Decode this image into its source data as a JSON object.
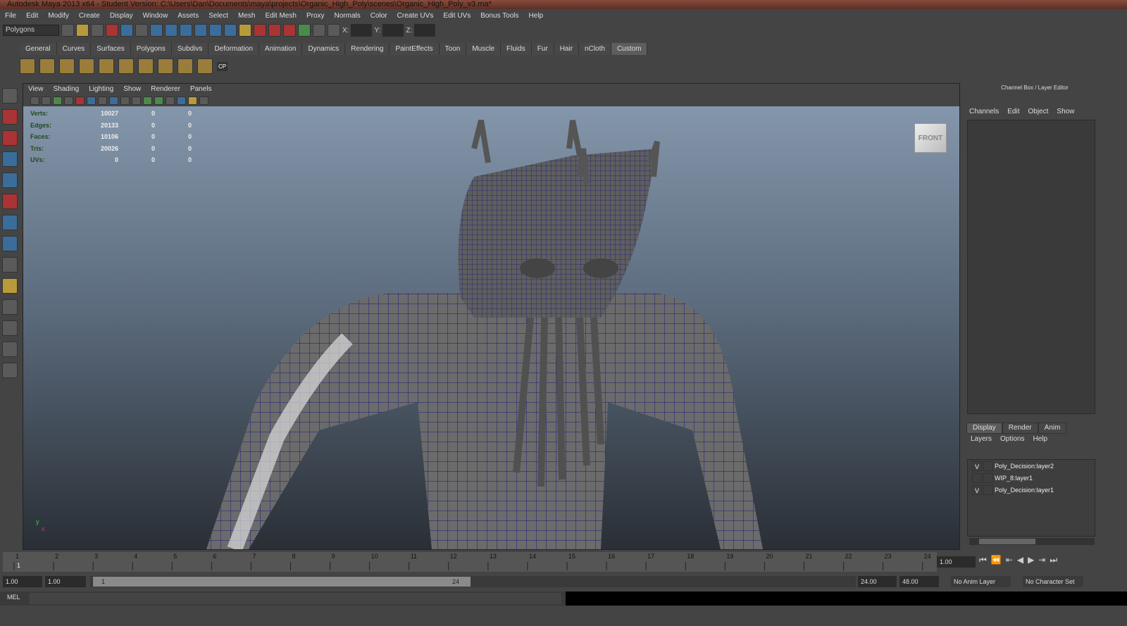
{
  "title": "Autodesk Maya 2013 x64 - Student Version: C:\\Users\\Dan\\Documents\\maya\\projects\\Organic_High_Poly\\scenes\\Organic_High_Poly_v3.ma*",
  "menu": [
    "File",
    "Edit",
    "Modify",
    "Create",
    "Display",
    "Window",
    "Assets",
    "Select",
    "Mesh",
    "Edit Mesh",
    "Proxy",
    "Normals",
    "Color",
    "Create UVs",
    "Edit UVs",
    "Bonus Tools",
    "Help"
  ],
  "toolbar": {
    "mode": "Polygons",
    "x_label": "X:",
    "y_label": "Y:",
    "z_label": "Z:"
  },
  "shelf_tabs": [
    "General",
    "Curves",
    "Surfaces",
    "Polygons",
    "Subdivs",
    "Deformation",
    "Animation",
    "Dynamics",
    "Rendering",
    "PaintEffects",
    "Toon",
    "Muscle",
    "Fluids",
    "Fur",
    "Hair",
    "nCloth",
    "Custom"
  ],
  "shelf_active": "Custom",
  "shelf_cp": "CP",
  "viewport": {
    "menu": [
      "View",
      "Shading",
      "Lighting",
      "Show",
      "Renderer",
      "Panels"
    ],
    "hud": [
      {
        "label": "Verts:",
        "v": [
          "10027",
          "0",
          "0"
        ]
      },
      {
        "label": "Edges:",
        "v": [
          "20133",
          "0",
          "0"
        ]
      },
      {
        "label": "Faces:",
        "v": [
          "10106",
          "0",
          "0"
        ]
      },
      {
        "label": "Tris:",
        "v": [
          "20026",
          "0",
          "0"
        ]
      },
      {
        "label": "UVs:",
        "v": [
          "0",
          "0",
          "0"
        ]
      }
    ],
    "view_cube": "FRONT",
    "axis_y": "y",
    "axis_x": "x"
  },
  "channel_box": {
    "title": "Channel Box / Layer Editor",
    "menu": [
      "Channels",
      "Edit",
      "Object",
      "Show"
    ]
  },
  "layer_editor": {
    "tabs": [
      "Display",
      "Render",
      "Anim"
    ],
    "active_tab": "Display",
    "menu": [
      "Layers",
      "Options",
      "Help"
    ],
    "layers": [
      {
        "vis": "V",
        "name": "Poly_Decision:layer2"
      },
      {
        "vis": "",
        "name": "WIP_8:layer1"
      },
      {
        "vis": "V",
        "name": "Poly_Decision:layer1"
      }
    ]
  },
  "timeline": {
    "ticks": [
      "1",
      "2",
      "3",
      "4",
      "5",
      "6",
      "7",
      "8",
      "9",
      "10",
      "11",
      "12",
      "13",
      "14",
      "15",
      "16",
      "17",
      "18",
      "19",
      "20",
      "21",
      "22",
      "23",
      "24"
    ],
    "current_frame": "1",
    "current_time": "1.00"
  },
  "range": {
    "start": "1.00",
    "playback_start": "1.00",
    "slider_start": "1",
    "slider_end": "24",
    "playback_end": "24.00",
    "end": "48.00",
    "anim_layer": "No Anim Layer",
    "character_set": "No Character Set"
  },
  "command": {
    "label": "MEL"
  },
  "colors": {
    "wire": "#1a1a7a",
    "mesh": "#6a6a6a"
  }
}
